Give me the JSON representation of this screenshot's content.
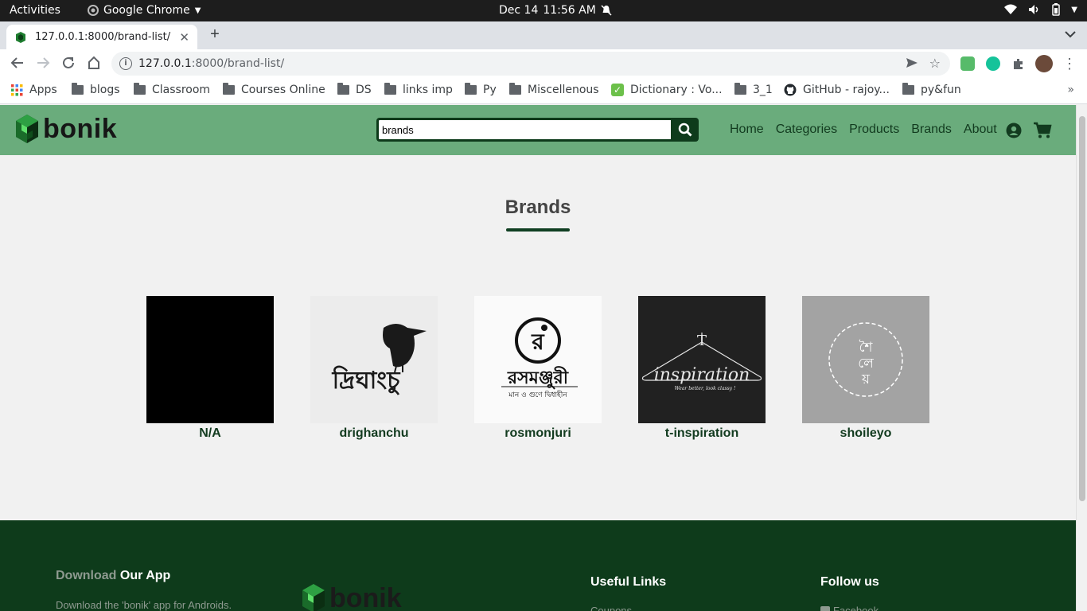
{
  "os": {
    "activities": "Activities",
    "app_name": "Google Chrome",
    "date": "Dec 14",
    "time": "11:56 AM"
  },
  "browser": {
    "tab_title": "127.0.0.1:8000/brand-list/",
    "url_host": "127.0.0.1",
    "url_path": ":8000/brand-list/",
    "bookmarks": [
      "Apps",
      "blogs",
      "Classroom",
      "Courses Online",
      "DS",
      "links imp",
      "Py",
      "Miscellenous",
      "Dictionary : Vo...",
      "3_1",
      "GitHub - rajoy...",
      "py&fun"
    ]
  },
  "site": {
    "logo_text": "bonik",
    "search_value": "brands",
    "nav": {
      "home": "Home",
      "categories": "Categories",
      "products": "Products",
      "brands": "Brands",
      "about": "About"
    }
  },
  "main": {
    "title": "Brands",
    "brands": [
      {
        "name": "N/A"
      },
      {
        "name": "drighanchu",
        "logo_text": "দ্রিঘাংচু"
      },
      {
        "name": "rosmonjuri",
        "logo_text": "রসমঞ্জুরী",
        "logo_letter": "র",
        "logo_sub": "মান ও গুণে দ্বিধাহীন"
      },
      {
        "name": "t-inspiration",
        "logo_text": "inspiration",
        "logo_letter": "T",
        "logo_sub": "Wear better, look classy !"
      },
      {
        "name": "shoileyo",
        "logo_lines": [
          "শৈ",
          "লে",
          "য়"
        ]
      }
    ]
  },
  "footer": {
    "download_prefix": "Download",
    "download_suffix": "Our App",
    "download_desc": "Download the 'bonik' app for Androids.",
    "logo_text": "bonik",
    "useful_links": "Useful Links",
    "coupons": "Coupons",
    "follow_us": "Follow us",
    "facebook": "Facebook"
  },
  "colors": {
    "header_bg": "#6aac7c",
    "dark_green": "#0e3b1b",
    "page_bg": "#f1f1f1"
  }
}
